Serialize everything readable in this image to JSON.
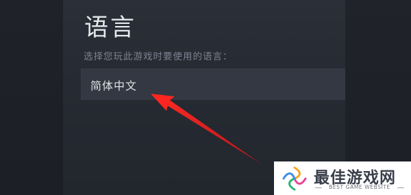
{
  "settings": {
    "title": "语言",
    "subtitle": "选择您玩此游戏时要使用的语言：",
    "selected_language": "简体中文"
  },
  "annotation": {
    "arrow_color": "#e01e1e"
  },
  "watermark": {
    "title": "最佳游戏网",
    "subtitle": "BEST GAME WEBSITE",
    "colors": [
      "#f5a623",
      "#e84393",
      "#2bb673",
      "#3a8ee6"
    ]
  }
}
